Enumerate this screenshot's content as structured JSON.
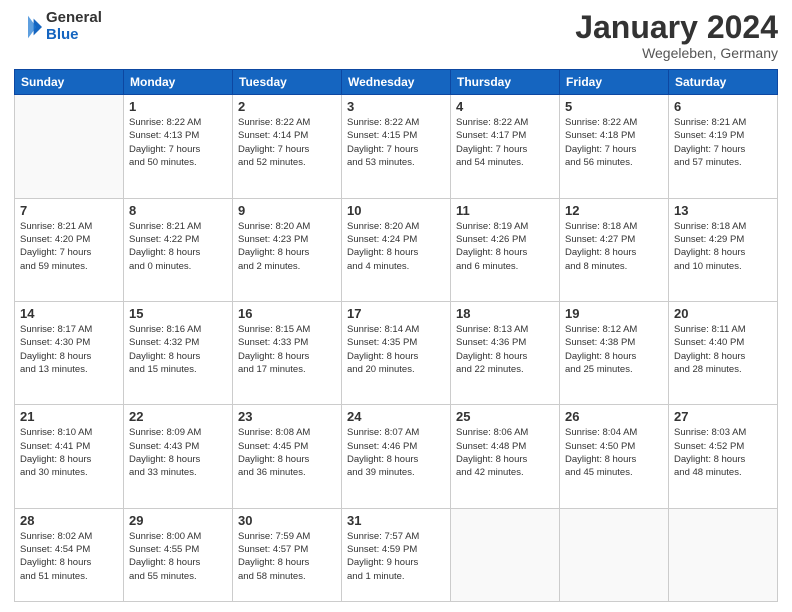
{
  "logo": {
    "general": "General",
    "blue": "Blue"
  },
  "title": "January 2024",
  "location": "Wegeleben, Germany",
  "days_of_week": [
    "Sunday",
    "Monday",
    "Tuesday",
    "Wednesday",
    "Thursday",
    "Friday",
    "Saturday"
  ],
  "weeks": [
    [
      {
        "day": "",
        "details": []
      },
      {
        "day": "1",
        "details": [
          "Sunrise: 8:22 AM",
          "Sunset: 4:13 PM",
          "Daylight: 7 hours",
          "and 50 minutes."
        ]
      },
      {
        "day": "2",
        "details": [
          "Sunrise: 8:22 AM",
          "Sunset: 4:14 PM",
          "Daylight: 7 hours",
          "and 52 minutes."
        ]
      },
      {
        "day": "3",
        "details": [
          "Sunrise: 8:22 AM",
          "Sunset: 4:15 PM",
          "Daylight: 7 hours",
          "and 53 minutes."
        ]
      },
      {
        "day": "4",
        "details": [
          "Sunrise: 8:22 AM",
          "Sunset: 4:17 PM",
          "Daylight: 7 hours",
          "and 54 minutes."
        ]
      },
      {
        "day": "5",
        "details": [
          "Sunrise: 8:22 AM",
          "Sunset: 4:18 PM",
          "Daylight: 7 hours",
          "and 56 minutes."
        ]
      },
      {
        "day": "6",
        "details": [
          "Sunrise: 8:21 AM",
          "Sunset: 4:19 PM",
          "Daylight: 7 hours",
          "and 57 minutes."
        ]
      }
    ],
    [
      {
        "day": "7",
        "details": [
          "Sunrise: 8:21 AM",
          "Sunset: 4:20 PM",
          "Daylight: 7 hours",
          "and 59 minutes."
        ]
      },
      {
        "day": "8",
        "details": [
          "Sunrise: 8:21 AM",
          "Sunset: 4:22 PM",
          "Daylight: 8 hours",
          "and 0 minutes."
        ]
      },
      {
        "day": "9",
        "details": [
          "Sunrise: 8:20 AM",
          "Sunset: 4:23 PM",
          "Daylight: 8 hours",
          "and 2 minutes."
        ]
      },
      {
        "day": "10",
        "details": [
          "Sunrise: 8:20 AM",
          "Sunset: 4:24 PM",
          "Daylight: 8 hours",
          "and 4 minutes."
        ]
      },
      {
        "day": "11",
        "details": [
          "Sunrise: 8:19 AM",
          "Sunset: 4:26 PM",
          "Daylight: 8 hours",
          "and 6 minutes."
        ]
      },
      {
        "day": "12",
        "details": [
          "Sunrise: 8:18 AM",
          "Sunset: 4:27 PM",
          "Daylight: 8 hours",
          "and 8 minutes."
        ]
      },
      {
        "day": "13",
        "details": [
          "Sunrise: 8:18 AM",
          "Sunset: 4:29 PM",
          "Daylight: 8 hours",
          "and 10 minutes."
        ]
      }
    ],
    [
      {
        "day": "14",
        "details": [
          "Sunrise: 8:17 AM",
          "Sunset: 4:30 PM",
          "Daylight: 8 hours",
          "and 13 minutes."
        ]
      },
      {
        "day": "15",
        "details": [
          "Sunrise: 8:16 AM",
          "Sunset: 4:32 PM",
          "Daylight: 8 hours",
          "and 15 minutes."
        ]
      },
      {
        "day": "16",
        "details": [
          "Sunrise: 8:15 AM",
          "Sunset: 4:33 PM",
          "Daylight: 8 hours",
          "and 17 minutes."
        ]
      },
      {
        "day": "17",
        "details": [
          "Sunrise: 8:14 AM",
          "Sunset: 4:35 PM",
          "Daylight: 8 hours",
          "and 20 minutes."
        ]
      },
      {
        "day": "18",
        "details": [
          "Sunrise: 8:13 AM",
          "Sunset: 4:36 PM",
          "Daylight: 8 hours",
          "and 22 minutes."
        ]
      },
      {
        "day": "19",
        "details": [
          "Sunrise: 8:12 AM",
          "Sunset: 4:38 PM",
          "Daylight: 8 hours",
          "and 25 minutes."
        ]
      },
      {
        "day": "20",
        "details": [
          "Sunrise: 8:11 AM",
          "Sunset: 4:40 PM",
          "Daylight: 8 hours",
          "and 28 minutes."
        ]
      }
    ],
    [
      {
        "day": "21",
        "details": [
          "Sunrise: 8:10 AM",
          "Sunset: 4:41 PM",
          "Daylight: 8 hours",
          "and 30 minutes."
        ]
      },
      {
        "day": "22",
        "details": [
          "Sunrise: 8:09 AM",
          "Sunset: 4:43 PM",
          "Daylight: 8 hours",
          "and 33 minutes."
        ]
      },
      {
        "day": "23",
        "details": [
          "Sunrise: 8:08 AM",
          "Sunset: 4:45 PM",
          "Daylight: 8 hours",
          "and 36 minutes."
        ]
      },
      {
        "day": "24",
        "details": [
          "Sunrise: 8:07 AM",
          "Sunset: 4:46 PM",
          "Daylight: 8 hours",
          "and 39 minutes."
        ]
      },
      {
        "day": "25",
        "details": [
          "Sunrise: 8:06 AM",
          "Sunset: 4:48 PM",
          "Daylight: 8 hours",
          "and 42 minutes."
        ]
      },
      {
        "day": "26",
        "details": [
          "Sunrise: 8:04 AM",
          "Sunset: 4:50 PM",
          "Daylight: 8 hours",
          "and 45 minutes."
        ]
      },
      {
        "day": "27",
        "details": [
          "Sunrise: 8:03 AM",
          "Sunset: 4:52 PM",
          "Daylight: 8 hours",
          "and 48 minutes."
        ]
      }
    ],
    [
      {
        "day": "28",
        "details": [
          "Sunrise: 8:02 AM",
          "Sunset: 4:54 PM",
          "Daylight: 8 hours",
          "and 51 minutes."
        ]
      },
      {
        "day": "29",
        "details": [
          "Sunrise: 8:00 AM",
          "Sunset: 4:55 PM",
          "Daylight: 8 hours",
          "and 55 minutes."
        ]
      },
      {
        "day": "30",
        "details": [
          "Sunrise: 7:59 AM",
          "Sunset: 4:57 PM",
          "Daylight: 8 hours",
          "and 58 minutes."
        ]
      },
      {
        "day": "31",
        "details": [
          "Sunrise: 7:57 AM",
          "Sunset: 4:59 PM",
          "Daylight: 9 hours",
          "and 1 minute."
        ]
      },
      {
        "day": "",
        "details": []
      },
      {
        "day": "",
        "details": []
      },
      {
        "day": "",
        "details": []
      }
    ]
  ]
}
